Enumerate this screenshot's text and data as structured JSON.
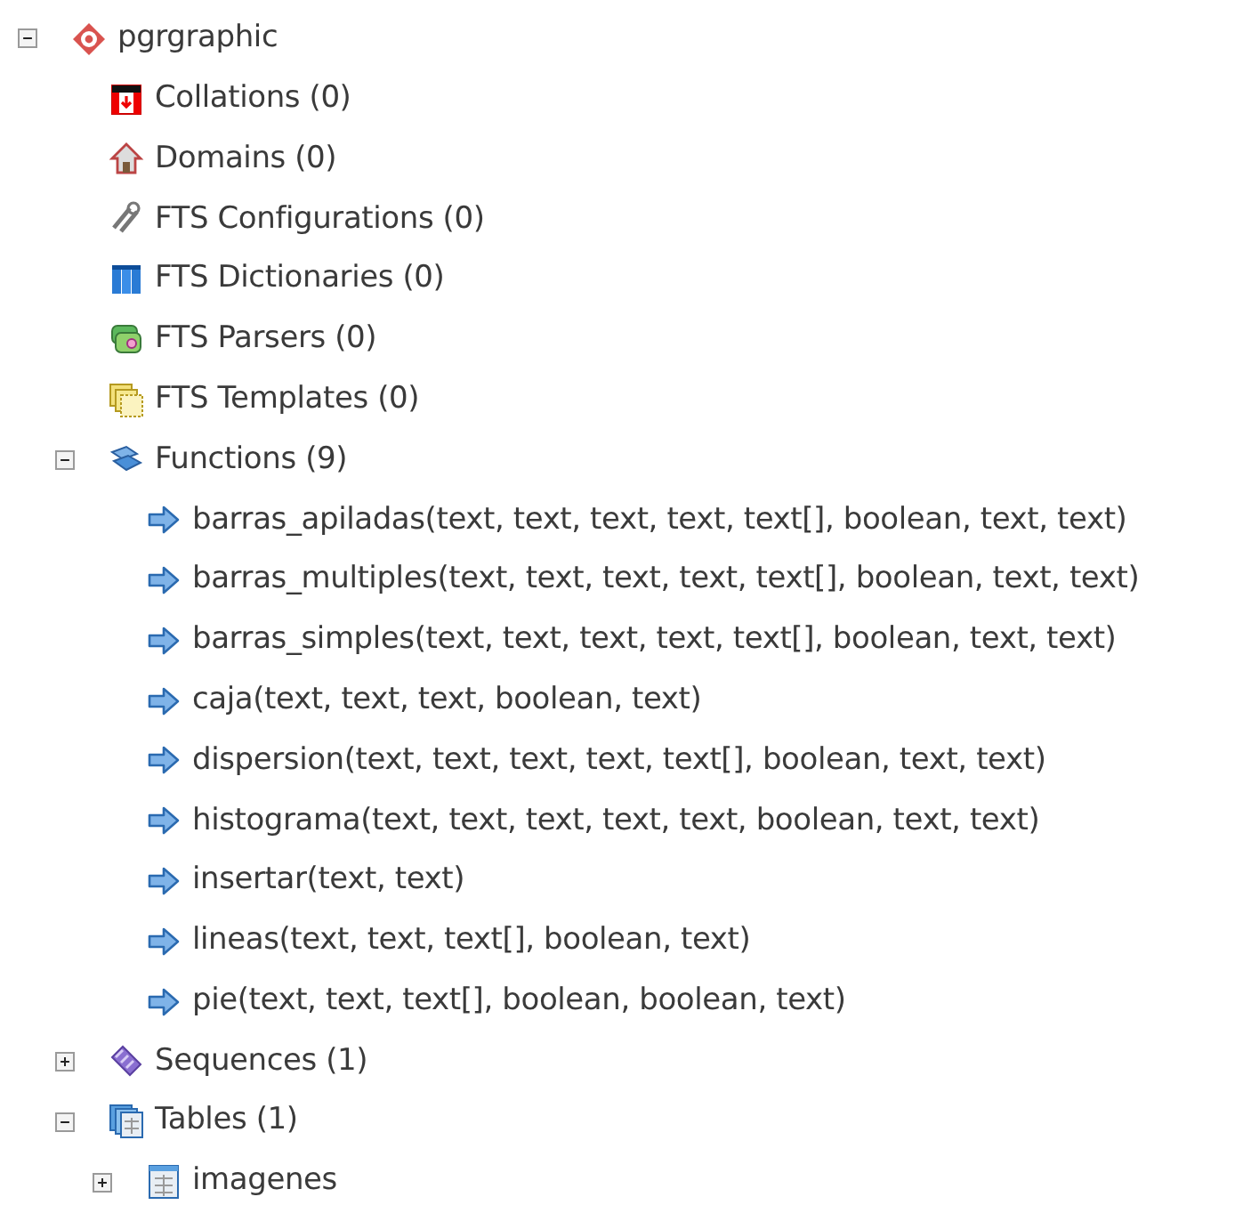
{
  "tree": [
    {
      "label": "pgrgraphic",
      "kind": "database",
      "expanded": true,
      "children": [
        {
          "label": "Collations (0)",
          "kind": "collation"
        },
        {
          "label": "Domains (0)",
          "kind": "domain"
        },
        {
          "label": "FTS Configurations (0)",
          "kind": "fts-config"
        },
        {
          "label": "FTS Dictionaries (0)",
          "kind": "fts-dict"
        },
        {
          "label": "FTS Parsers (0)",
          "kind": "fts-parser"
        },
        {
          "label": "FTS Templates (0)",
          "kind": "fts-template"
        },
        {
          "label": "Functions (9)",
          "kind": "functions",
          "expanded": true,
          "children": [
            {
              "label": "barras_apiladas(text, text, text, text, text[], boolean, text, text)",
              "kind": "function"
            },
            {
              "label": "barras_multiples(text, text, text, text, text[], boolean, text, text)",
              "kind": "function"
            },
            {
              "label": "barras_simples(text, text, text, text, text[], boolean, text, text)",
              "kind": "function"
            },
            {
              "label": "caja(text, text, text, boolean, text)",
              "kind": "function"
            },
            {
              "label": "dispersion(text, text, text, text, text[], boolean, text, text)",
              "kind": "function"
            },
            {
              "label": "histograma(text, text, text, text, text, boolean, text, text)",
              "kind": "function"
            },
            {
              "label": "insertar(text, text)",
              "kind": "function"
            },
            {
              "label": "lineas(text, text, text[], boolean, text)",
              "kind": "function"
            },
            {
              "label": "pie(text, text, text[], boolean, boolean, text)",
              "kind": "function"
            }
          ]
        },
        {
          "label": "Sequences (1)",
          "kind": "sequences",
          "expanded": false
        },
        {
          "label": "Tables (1)",
          "kind": "tables",
          "expanded": true,
          "children": [
            {
              "label": "imagenes",
              "kind": "table",
              "expanded": false
            }
          ]
        }
      ]
    }
  ]
}
